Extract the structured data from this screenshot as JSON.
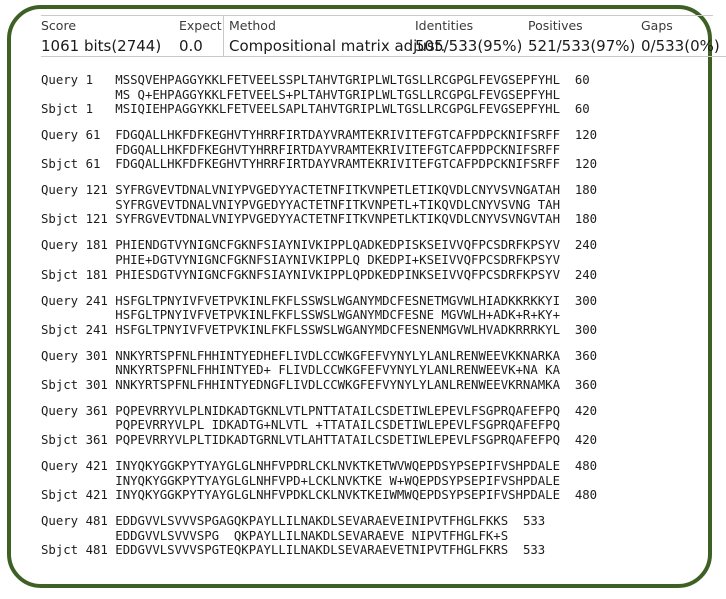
{
  "frame": {
    "border_color": "#3f6024",
    "background": "#ffffff"
  },
  "stats": {
    "columns": [
      {
        "key": "score",
        "header": "Score",
        "value": "1061 bits(2744)"
      },
      {
        "key": "expect",
        "header": "Expect",
        "value": "0.0"
      },
      {
        "key": "method",
        "header": "Method",
        "value": "Compositional matrix adjust."
      },
      {
        "key": "identities",
        "header": "Identities",
        "value": "505/533(95%)"
      },
      {
        "key": "positives",
        "header": "Positives",
        "value": "521/533(97%)"
      },
      {
        "key": "gaps",
        "header": "Gaps",
        "value": "0/533(0%)"
      }
    ]
  },
  "alignment": {
    "query_label": "Query",
    "sbjct_label": "Sbjct",
    "blocks": [
      {
        "query_start": "1",
        "query_end": "60",
        "query_seq": "MSSQVEHPAGGYKKLFETVEELSSPLTAHVTGRIPLWLTGSLLRCGPGLFEVGSEPFYHL",
        "midline": "MS Q+EHPAGGYKKLFETVEELS+PLTAHVTGRIPLWLTGSLLRCGPGLFEVGSEPFYHL",
        "sbjct_start": "1",
        "sbjct_end": "60",
        "sbjct_seq": "MSIQIEHPAGGYKKLFETVEELSAPLTAHVTGRIPLWLTGSLLRCGPGLFEVGSEPFYHL"
      },
      {
        "query_start": "61",
        "query_end": "120",
        "query_seq": "FDGQALLHKFDFKEGHVTYHRRFIRTDAYVRAMTEKRIVITEFGTCAFPDPCKNIFSRFF",
        "midline": "FDGQALLHKFDFKEGHVTYHRRFIRTDAYVRAMTEKRIVITEFGTCAFPDPCKNIFSRFF",
        "sbjct_start": "61",
        "sbjct_end": "120",
        "sbjct_seq": "FDGQALLHKFDFKEGHVTYHRRFIRTDAYVRAMTEKRIVITEFGTCAFPDPCKNIFSRFF"
      },
      {
        "query_start": "121",
        "query_end": "180",
        "query_seq": "SYFRGVEVTDNALVNIYPVGEDYYACTETNFITKVNPETLETIKQVDLCNYVSVNGATAH",
        "midline": "SYFRGVEVTDNALVNIYPVGEDYYACTETNFITKVNPETL+TIKQVDLCNYVSVNG TAH",
        "sbjct_start": "121",
        "sbjct_end": "180",
        "sbjct_seq": "SYFRGVEVTDNALVNIYPVGEDYYACTETNFITKVNPETLKTIKQVDLCNYVSVNGVTAH"
      },
      {
        "query_start": "181",
        "query_end": "240",
        "query_seq": "PHIENDGTVYNIGNCFGKNFSIAYNIVKIPPLQADKEDPISKSEIVVQFPCSDRFKPSYV",
        "midline": "PHIE+DGTVYNIGNCFGKNFSIAYNIVKIPPLQ DKEDPI+KSEIVVQFPCSDRFKPSYV",
        "sbjct_start": "181",
        "sbjct_end": "240",
        "sbjct_seq": "PHIESDGTVYNIGNCFGKNFSIAYNIVKIPPLQPDKEDPINKSEIVVQFPCSDRFKPSYV"
      },
      {
        "query_start": "241",
        "query_end": "300",
        "query_seq": "HSFGLTPNYIVFVETPVKINLFKFLSSWSLWGANYMDCFESNETMGVWLHIADKKRKKYI",
        "midline": "HSFGLTPNYIVFVETPVKINLFKFLSSWSLWGANYMDCFESNE MGVWLH+ADK+R+KY+",
        "sbjct_start": "241",
        "sbjct_end": "300",
        "sbjct_seq": "HSFGLTPNYIVFVETPVKINLFKFLSSWSLWGANYMDCFESNENMGVWLHVADKRRRKYL"
      },
      {
        "query_start": "301",
        "query_end": "360",
        "query_seq": "NNKYRTSPFNLFHHINTYEDHEFLIVDLCCWKGFEFVYNYLYLANLRENWEEVKKNARKA",
        "midline": "NNKYRTSPFNLFHHINTYED+ FLIVDLCCWKGFEFVYNYLYLANLRENWEEVK+NA KA",
        "sbjct_start": "301",
        "sbjct_end": "360",
        "sbjct_seq": "NNKYRTSPFNLFHHINTYEDNGFLIVDLCCWKGFEFVYNYLYLANLRENWEEVKRNAMKA"
      },
      {
        "query_start": "361",
        "query_end": "420",
        "query_seq": "PQPEVRRYVLPLNIDKADTGKNLVTLPNTTATAILCSDETIWLEPEVLFSGPRQAFEFPQ",
        "midline": "PQPEVRRYVLPL IDKADTG+NLVTL +TTATAILCSDETIWLEPEVLFSGPRQAFEFPQ",
        "sbjct_start": "361",
        "sbjct_end": "420",
        "sbjct_seq": "PQPEVRRYVLPLTIDKADTGRNLVTLAHTTATAILCSDETIWLEPEVLFSGPRQAFEFPQ"
      },
      {
        "query_start": "421",
        "query_end": "480",
        "query_seq": "INYQKYGGKPYTYAYGLGLNHFVPDRLCKLNVKTKETWVWQEPDSYPSEPIFVSHPDALE",
        "midline": "INYQKYGGKPYTYAYGLGLNHFVPD+LCKLNVKTKE W+WQEPDSYPSEPIFVSHPDALE",
        "sbjct_start": "421",
        "sbjct_end": "480",
        "sbjct_seq": "INYQKYGGKPYTYAYGLGLNHFVPDKLCKLNVKTKEIWMWQEPDSYPSEPIFVSHPDALE"
      },
      {
        "query_start": "481",
        "query_end": "533",
        "query_seq": "EDDGVVLSVVVSPGAGQKPAYLLILNAKDLSEVARAEVEINIPVTFHGLFKKS",
        "midline": "EDDGVVLSVVVSPG  QKPAYLLILNAKDLSEVARAEVE NIPVTFHGLFK+S",
        "sbjct_start": "481",
        "sbjct_end": "533",
        "sbjct_seq": "EDDGVVLSVVVSPGTEQKPAYLLILNAKDLSEVARAEVETNIPVTFHGLFKRS"
      }
    ]
  }
}
